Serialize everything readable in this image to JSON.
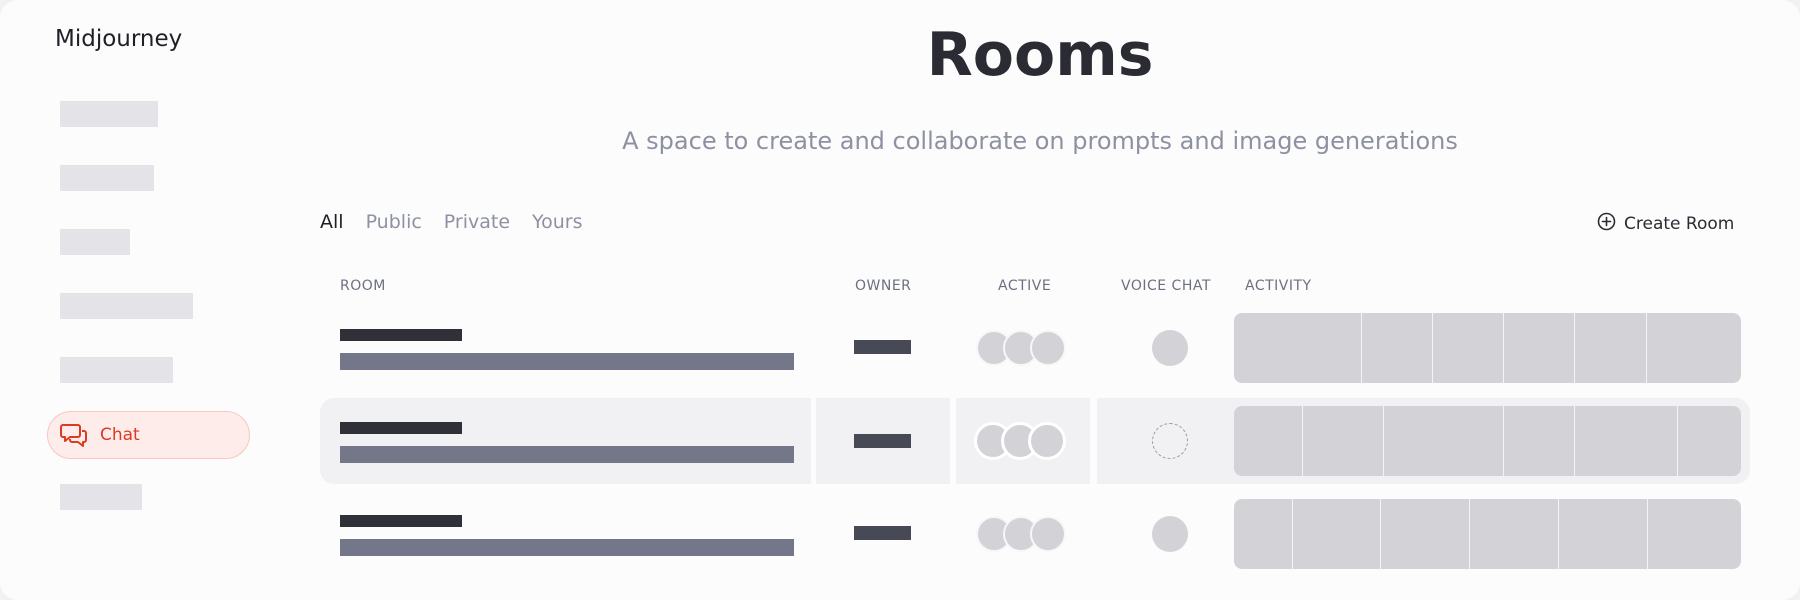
{
  "app": {
    "brand": "Midjourney"
  },
  "sidebar": {
    "active_item": {
      "label": "Chat",
      "icon": "chat-bubbles-icon"
    },
    "accent_color": "#dc3a21"
  },
  "header": {
    "title": "Rooms",
    "subtitle": "A space to create and collaborate on prompts and image generations"
  },
  "filters": {
    "tabs": [
      {
        "label": "All",
        "active": true
      },
      {
        "label": "Public",
        "active": false
      },
      {
        "label": "Private",
        "active": false
      },
      {
        "label": "Yours",
        "active": false
      }
    ],
    "create_label": "Create Room",
    "create_icon": "plus-circle-icon"
  },
  "table": {
    "columns": [
      "ROOM",
      "OWNER",
      "ACTIVE",
      "VOICE CHAT",
      "ACTIVITY"
    ],
    "rows": [
      {
        "highlighted": false,
        "voice_state": "filled"
      },
      {
        "highlighted": true,
        "voice_state": "empty"
      },
      {
        "highlighted": false,
        "voice_state": "filled"
      }
    ]
  }
}
